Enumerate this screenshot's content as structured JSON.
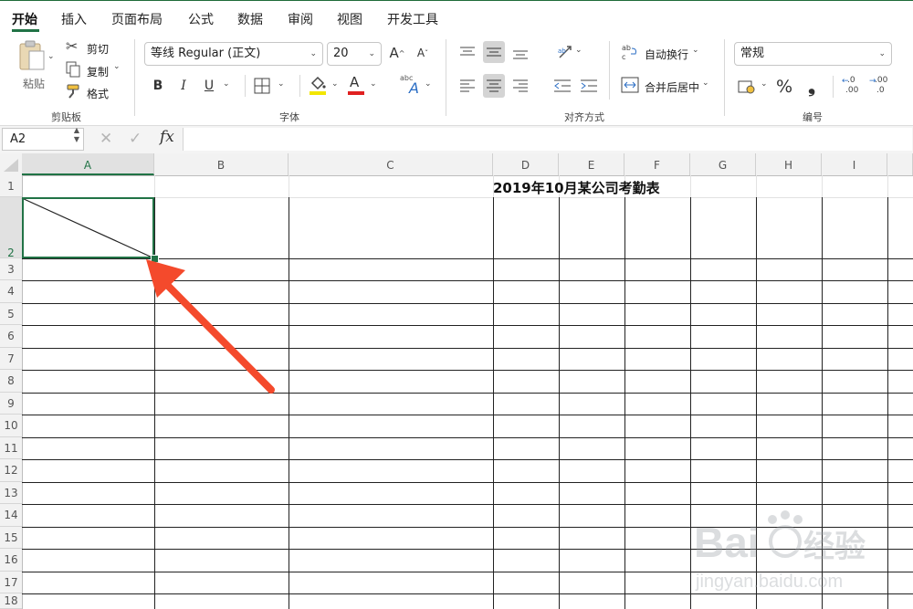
{
  "menu": {
    "tabs": [
      "开始",
      "插入",
      "页面布局",
      "公式",
      "数据",
      "审阅",
      "视图",
      "开发工具"
    ],
    "active": "开始"
  },
  "clipboard": {
    "paste_label": "粘贴",
    "cut_label": "剪切",
    "copy_label": "复制",
    "format_painter_label": "格式",
    "group_label": "剪贴板"
  },
  "font": {
    "family_value": "等线 Regular (正文)",
    "size_value": "20",
    "bold": "B",
    "italic": "I",
    "underline": "U",
    "group_label": "字体",
    "highlight_color": "#f2e600",
    "font_color": "#e02020",
    "grow_glyph": "A",
    "shrink_glyph": "A",
    "font_color_glyph": "A",
    "phonetic_small": "abc",
    "phonetic_glyph": "A"
  },
  "alignment": {
    "wrap_label": "自动换行",
    "merge_label": "合并后居中",
    "group_label": "对齐方式"
  },
  "number": {
    "format_value": "常规",
    "percent_glyph": "%",
    "comma_glyph": "❟",
    "inc_top": ".0",
    "inc_bottom": ".00",
    "dec_top": ".00",
    "dec_bottom": ".0",
    "group_label": "编号"
  },
  "formula_bar": {
    "name_box": "A2",
    "fx_label": "fx",
    "cancel_glyph": "✕",
    "enter_glyph": "✓",
    "content": ""
  },
  "sheet": {
    "columns": [
      "A",
      "B",
      "C",
      "D",
      "E",
      "F",
      "G",
      "H",
      "I"
    ],
    "rows": [
      "1",
      "2",
      "3",
      "4",
      "5",
      "6",
      "7",
      "8",
      "9",
      "10",
      "11",
      "12",
      "13",
      "14",
      "15",
      "16",
      "17",
      "18"
    ],
    "active_column": "A",
    "active_row": "2",
    "title": "2019年10月某公司考勤表"
  },
  "annotation": {
    "arrow_color": "#f44a2c"
  },
  "colors": {
    "accent": "#217346"
  }
}
